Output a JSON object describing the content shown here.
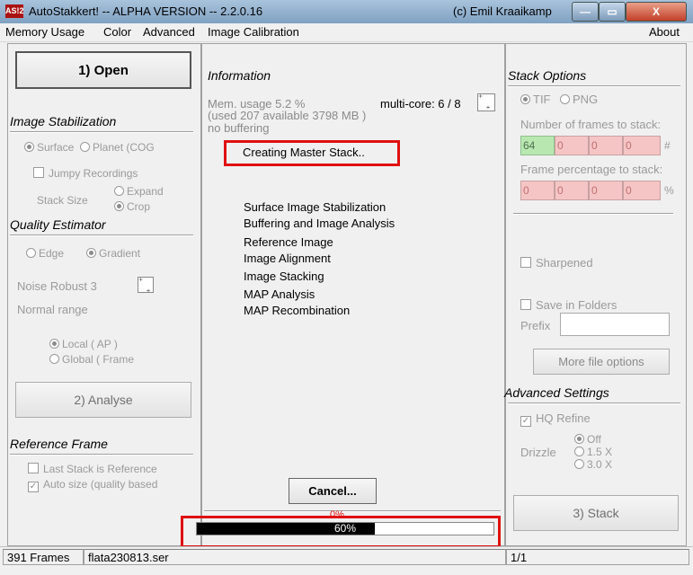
{
  "window": {
    "app_icon_text": "AS!2",
    "title": "AutoStakkert! -- ALPHA VERSION -- 2.2.0.16",
    "copyright": "(c) Emil Kraaikamp",
    "min_symbol": "—",
    "max_symbol": "▭",
    "close_symbol": "X"
  },
  "menu": {
    "items": [
      "Memory Usage",
      "Color",
      "Advanced",
      "Image Calibration"
    ],
    "about": "About"
  },
  "left": {
    "open_button": "1) Open",
    "image_stabilization": {
      "heading": "Image Stabilization",
      "surface": "Surface",
      "planet": "Planet (COG",
      "jumpy": "Jumpy Recordings",
      "stack_size": "Stack Size",
      "expand": "Expand",
      "crop": "Crop"
    },
    "quality_estimator": {
      "heading": "Quality Estimator",
      "edge": "Edge",
      "gradient": "Gradient",
      "noise_robust": "Noise Robust 3",
      "normal_range": "Normal range",
      "local": "Local    ( AP )",
      "global": "Global   ( Frame"
    },
    "analyse_button": "2) Analyse",
    "reference_frame": {
      "heading": "Reference Frame",
      "last_stack": "Last Stack is Reference",
      "auto_size": "Auto size (quality based"
    }
  },
  "center": {
    "heading": "Information",
    "mem_usage": "Mem. usage 5.2 %",
    "mem_detail": "(used 207 available 3798 MB )",
    "buffering": "no buffering",
    "multicore": "multi-core: 6 / 8",
    "status": "Creating Master Stack..",
    "steps": [
      "Surface Image Stabilization",
      "Buffering and Image Analysis",
      "Reference Image",
      "Image Alignment",
      "Image Stacking",
      "MAP Analysis",
      "MAP Recombination"
    ],
    "cancel_button": "Cancel...",
    "progress_top_label": "0%",
    "progress_label": "60%",
    "progress_value": 0.6
  },
  "right": {
    "stack_options": {
      "heading": "Stack Options",
      "tif": "TIF",
      "png": "PNG",
      "frames_label": "Number of frames to stack:",
      "frames_values": [
        "64",
        "0",
        "0",
        "0"
      ],
      "frames_unit": "#",
      "percent_label": "Frame percentage to stack:",
      "percent_values": [
        "0",
        "0",
        "0",
        "0"
      ],
      "percent_unit": "%"
    },
    "sharpened": "Sharpened",
    "save_in_folders": "Save in Folders",
    "prefix_label": "Prefix",
    "prefix_value": "",
    "more_file_options": "More file options",
    "advanced_settings": {
      "heading": "Advanced Settings",
      "hq_refine": "HQ Refine",
      "drizzle": "Drizzle",
      "off": "Off",
      "x15": "1.5 X",
      "x30": "3.0 X"
    },
    "stack_button": "3) Stack"
  },
  "statusbar": {
    "frames": "391 Frames",
    "file": "flata230813.ser",
    "page": "1/1"
  },
  "colors": {
    "highlight_box": "#e01010",
    "frames_green": "#b8e8b0",
    "frames_red": "#f5c5c5",
    "progress_fill": "#000000"
  }
}
